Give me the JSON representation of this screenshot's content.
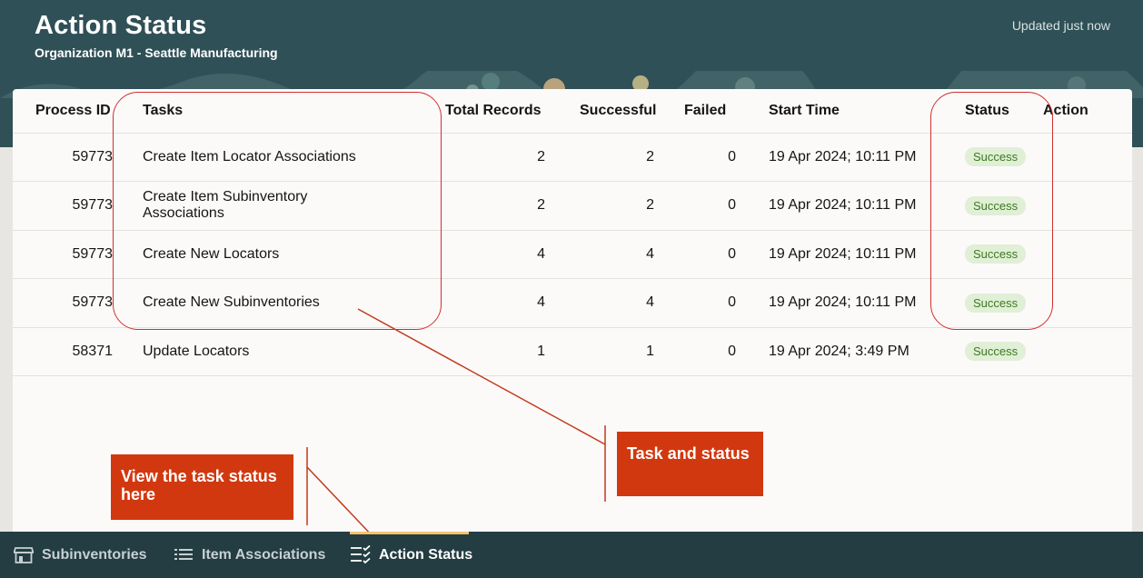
{
  "header": {
    "title": "Action Status",
    "subtitle": "Organization M1 - Seattle Manufacturing",
    "updated": "Updated just now"
  },
  "table": {
    "columns": [
      "Process ID",
      "Tasks",
      "Total Records",
      "Successful",
      "Failed",
      "Start Time",
      "Status",
      "Action"
    ],
    "rows": [
      {
        "pid": "59773",
        "task": "Create Item Locator Associations",
        "total": "2",
        "successful": "2",
        "failed": "0",
        "start": "19 Apr 2024; 10:11 PM",
        "status": "Success"
      },
      {
        "pid": "59773",
        "task": "Create Item Subinventory Associations",
        "total": "2",
        "successful": "2",
        "failed": "0",
        "start": "19 Apr 2024; 10:11 PM",
        "status": "Success"
      },
      {
        "pid": "59773",
        "task": "Create New Locators",
        "total": "4",
        "successful": "4",
        "failed": "0",
        "start": "19 Apr 2024; 10:11 PM",
        "status": "Success"
      },
      {
        "pid": "59773",
        "task": "Create New Subinventories",
        "total": "4",
        "successful": "4",
        "failed": "0",
        "start": "19 Apr 2024; 10:11 PM",
        "status": "Success"
      },
      {
        "pid": "58371",
        "task": "Update Locators",
        "total": "1",
        "successful": "1",
        "failed": "0",
        "start": "19 Apr 2024; 3:49 PM",
        "status": "Success"
      }
    ]
  },
  "callouts": {
    "task_status": "Task and status",
    "view_here": "View the task status here"
  },
  "nav": {
    "items": [
      {
        "label": "Subinventories",
        "icon": "store-icon"
      },
      {
        "label": "Item Associations",
        "icon": "list-icon"
      },
      {
        "label": "Action Status",
        "icon": "checklist-icon"
      }
    ]
  },
  "colors": {
    "header_bg": "#2f5056",
    "nav_bg": "#233d42",
    "callout_bg": "#d2380f",
    "annotation_red": "#d22e2e",
    "success_badge_bg": "#e0efd6",
    "success_badge_text": "#3b7a1f",
    "active_tab_bar": "#f3c36e"
  }
}
